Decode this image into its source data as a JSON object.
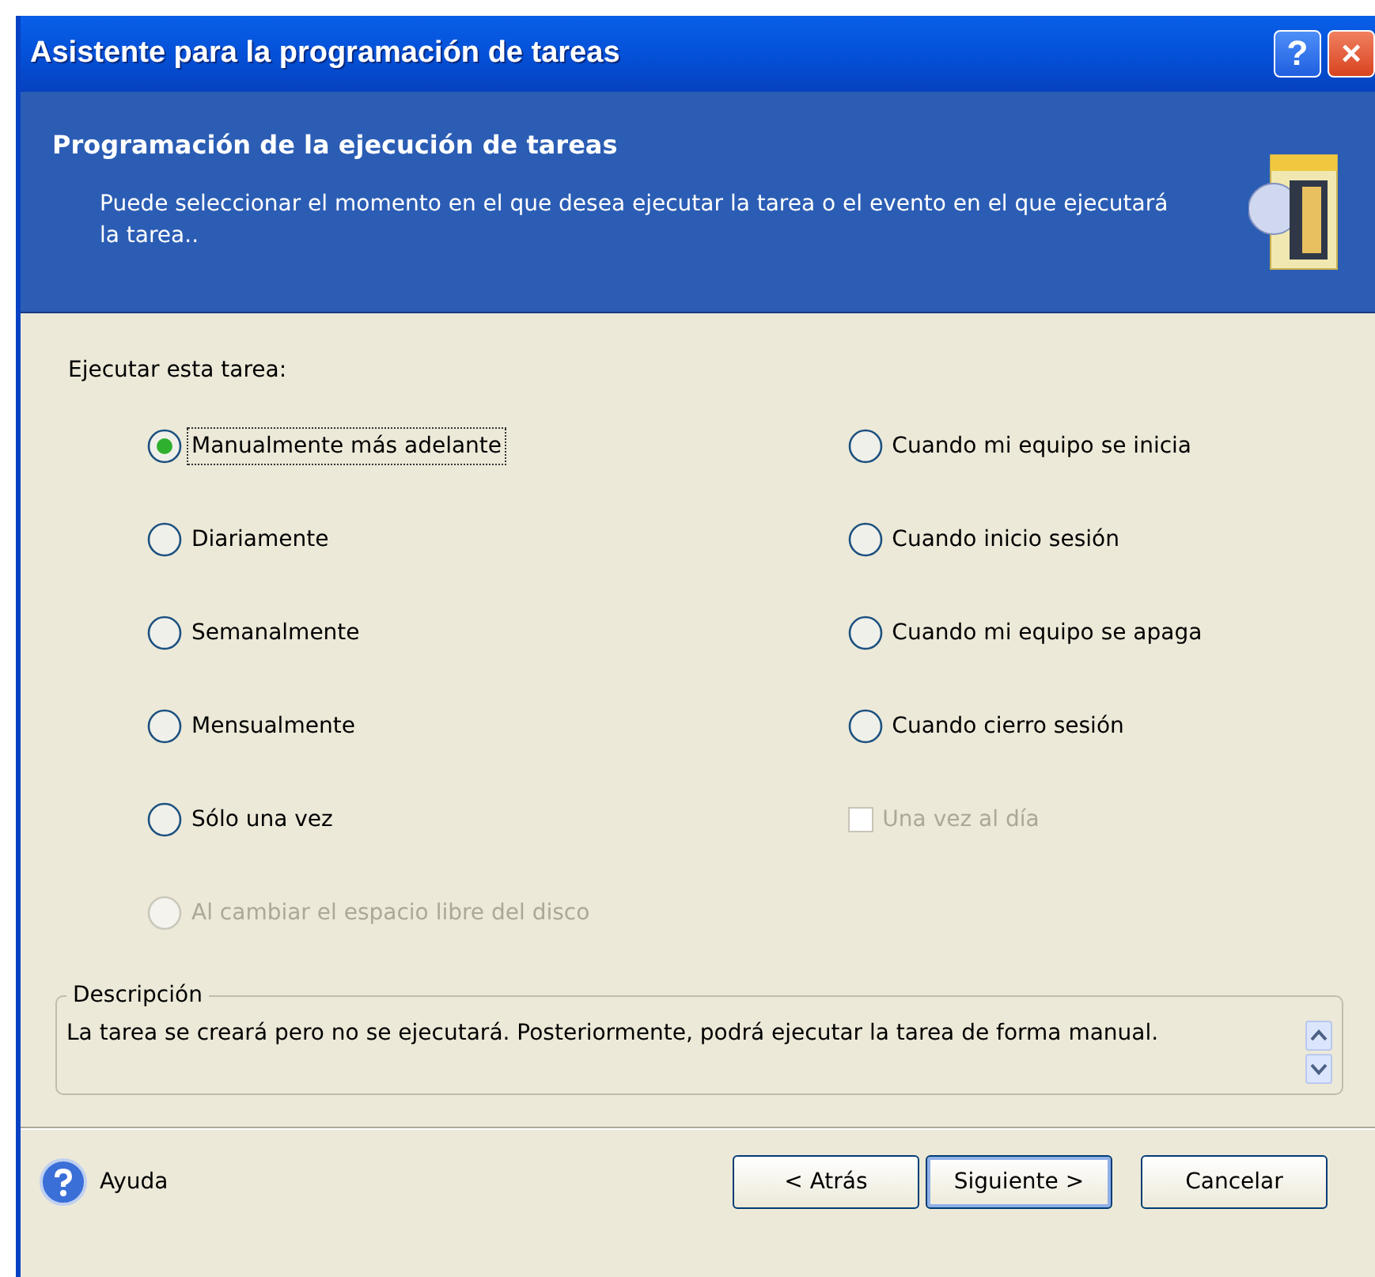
{
  "window": {
    "title": "Asistente para la programación de tareas",
    "buttons": [
      {
        "kind": "help",
        "label": "?"
      },
      {
        "kind": "close",
        "label": "×"
      }
    ]
  },
  "header": {
    "title": "Programación de la ejecución de tareas",
    "description": "Puede seleccionar el momento en el que desea ejecutar la tarea o el evento en el que ejecutará la tarea.."
  },
  "prompt": "Ejecutar esta tarea:",
  "left_options": [
    {
      "kind": "radio",
      "label": "Manualmente más adelante",
      "selected": true,
      "disabled": false,
      "focused": true
    },
    {
      "kind": "radio",
      "label": "Diariamente",
      "selected": false,
      "disabled": false,
      "focused": false
    },
    {
      "kind": "radio",
      "label": "Semanalmente",
      "selected": false,
      "disabled": false,
      "focused": false
    },
    {
      "kind": "radio",
      "label": "Mensualmente",
      "selected": false,
      "disabled": false,
      "focused": false
    },
    {
      "kind": "radio",
      "label": "Sólo una vez",
      "selected": false,
      "disabled": false,
      "focused": false
    },
    {
      "kind": "radio",
      "label": "Al cambiar el espacio libre del disco",
      "selected": false,
      "disabled": true,
      "focused": false
    }
  ],
  "right_options": [
    {
      "kind": "radio",
      "label": "Cuando mi equipo se inicia",
      "selected": false,
      "disabled": false,
      "focused": false
    },
    {
      "kind": "radio",
      "label": "Cuando inicio sesión",
      "selected": false,
      "disabled": false,
      "focused": false
    },
    {
      "kind": "radio",
      "label": "Cuando mi equipo se apaga",
      "selected": false,
      "disabled": false,
      "focused": false
    },
    {
      "kind": "radio",
      "label": "Cuando cierro sesión",
      "selected": false,
      "disabled": false,
      "focused": false
    },
    {
      "kind": "checkbox",
      "label": "Una vez al día",
      "checked": false,
      "disabled": true,
      "focused": false
    }
  ],
  "description": {
    "legend": "Descripción",
    "text": "La tarea se creará pero no se ejecutará. Posteriormente, podrá ejecutar la tarea de forma manual."
  },
  "help": {
    "label": "Ayuda"
  },
  "buttons": [
    {
      "label": "< Atrás",
      "default": false
    },
    {
      "label": "Siguiente >",
      "default": true
    },
    {
      "label": "Cancelar",
      "default": false
    }
  ]
}
